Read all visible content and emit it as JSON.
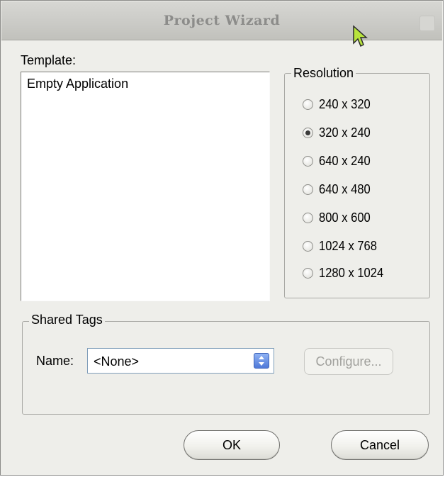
{
  "window": {
    "title": "Project Wizard"
  },
  "template": {
    "label": "Template:",
    "items": [
      "Empty Application"
    ]
  },
  "resolution": {
    "group_label": "Resolution",
    "options": [
      "240 x 320",
      "320 x 240",
      "640 x 240",
      "640 x 480",
      "800 x 600",
      "1024 x 768",
      "1280 x 1024"
    ],
    "selected": "320 x 240"
  },
  "shared_tags": {
    "group_label": "Shared Tags",
    "name_label": "Name:",
    "name_value": "<None>",
    "configure_label": "Configure..."
  },
  "buttons": {
    "ok": "OK",
    "cancel": "Cancel"
  },
  "colors": {
    "titlebar": "#cdcdc9",
    "dialog_bg": "#eeeeea",
    "combo_arrow": "#4f79d8"
  }
}
